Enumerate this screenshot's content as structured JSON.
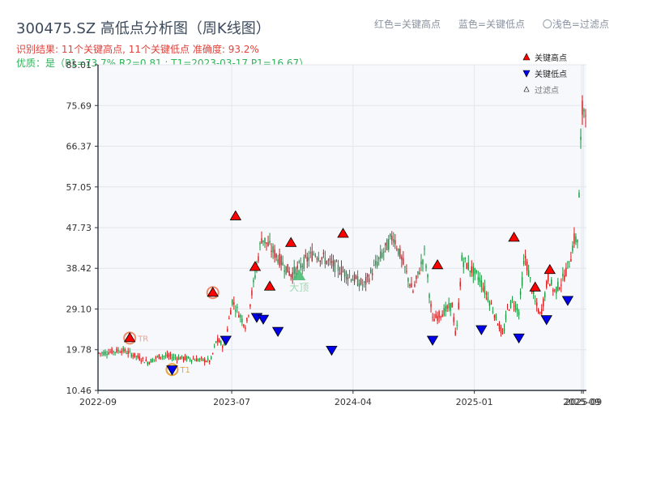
{
  "header": {
    "title": "300475.SZ 高低点分析图（周K线图）",
    "result_line": "识别结果: 11个关键高点, 11个关键低点   准确度: 93.2%",
    "quality_line": "优质：是（P1=73.7%  R2=0.81 ; T1=2023-03-17 P1=16.67）"
  },
  "top_legend": {
    "red": "红色=关键高点",
    "blue": "蓝色=关键低点",
    "light": "〇浅色=过滤点"
  },
  "inner_legend": {
    "high": "关键高点",
    "low": "关键低点",
    "filtered": "过滤点"
  },
  "annotations": {
    "t1": "T1",
    "tr": "TR",
    "big": "大顶"
  },
  "colors": {
    "up": "#d7191c",
    "down": "#1a9641",
    "high_marker": "#ff0000",
    "low_marker": "#0000ee",
    "plot_bg": "#f6f8fb",
    "grid": "#e2e6ec",
    "ring": "#e8a33d"
  },
  "chart_data": {
    "type": "candlestick",
    "title": "300475.SZ 高低点分析图（周K线图）",
    "yticks": [
      10.46,
      19.78,
      29.1,
      38.42,
      47.73,
      57.05,
      66.37,
      75.69,
      85.01
    ],
    "ylim": [
      10.46,
      85.01
    ],
    "xticks": [
      {
        "label": "2022-09",
        "date": "2022-09-01"
      },
      {
        "label": "2023-07",
        "date": "2023-07-01"
      },
      {
        "label": "2024-04",
        "date": "2024-04-01"
      },
      {
        "label": "2025-01",
        "date": "2025-01-01"
      },
      {
        "label": "2025-09",
        "date": "2025-09-01"
      },
      {
        "label": "2025-09",
        "date": "2025-09-05"
      }
    ],
    "xlim": [
      "2022-09-01",
      "2025-09-12"
    ],
    "key_points": [
      1.0,
      12.0,
      18.0,
      25.0,
      31.5,
      57.0,
      60.0,
      64.0,
      68.0,
      75.0,
      83.0,
      98.0,
      110.0,
      135.0,
      150.0,
      160.0,
      166.0,
      170.0,
      180.0,
      182.0,
      185.0,
      194.0,
      199.0,
      206.0,
      208.0,
      211.0,
      214.0,
      217.0,
      222.0,
      225.0,
      229.0,
      232.0,
      236.0,
      240.0,
      242.0,
      244.0,
      246.0,
      248.0
    ],
    "key_values": [
      19.0,
      19.7,
      18.5,
      16.9,
      18.4,
      17.2,
      22.0,
      20.5,
      31.0,
      25.0,
      45.6,
      37.0,
      42.0,
      34.5,
      46.0,
      33.0,
      42.0,
      26.5,
      30.0,
      22.0,
      40.5,
      36.0,
      31.0,
      22.8,
      29.0,
      31.0,
      28.5,
      41.5,
      31.0,
      27.5,
      36.5,
      33.0,
      35.5,
      40.0,
      45.0,
      45.0,
      74.0,
      76.0
    ],
    "bar_count": 250,
    "highs": [
      {
        "i": 19,
        "v": 20.6,
        "ring": true
      },
      {
        "i": 70,
        "v": 31.0,
        "ring": true
      },
      {
        "i": 84,
        "v": 48.5
      },
      {
        "i": 96,
        "v": 36.9
      },
      {
        "i": 105,
        "v": 32.4
      },
      {
        "i": 118,
        "v": 42.4
      },
      {
        "i": 150,
        "v": 44.5
      },
      {
        "i": 208,
        "v": 37.3
      },
      {
        "i": 255,
        "v": 43.6
      },
      {
        "i": 268,
        "v": 32.2
      },
      {
        "i": 277,
        "v": 36.2
      }
    ],
    "lows": [
      {
        "i": 45,
        "v": 17.1,
        "ring": true
      },
      {
        "i": 78,
        "v": 23.9
      },
      {
        "i": 97,
        "v": 29.1
      },
      {
        "i": 101,
        "v": 28.7
      },
      {
        "i": 110,
        "v": 25.9
      },
      {
        "i": 143,
        "v": 21.6
      },
      {
        "i": 205,
        "v": 23.9
      },
      {
        "i": 235,
        "v": 26.3
      },
      {
        "i": 258,
        "v": 24.4
      },
      {
        "i": 275,
        "v": 28.6
      },
      {
        "i": 288,
        "v": 33.0
      }
    ],
    "filtered": [
      {
        "i": 123,
        "v": 36.6
      }
    ]
  }
}
